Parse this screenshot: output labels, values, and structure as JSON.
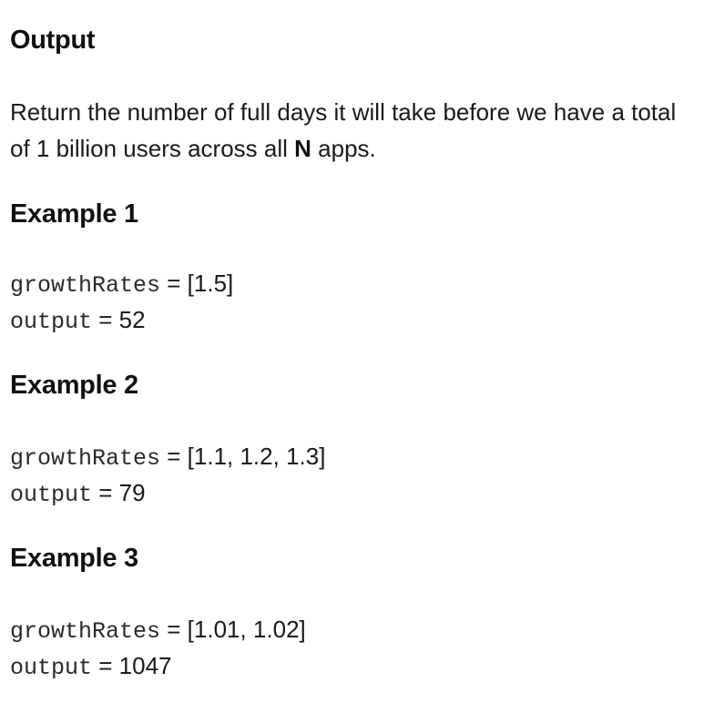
{
  "output_section": {
    "heading": "Output",
    "text_before": "Return the number of full days it will take before we have a total of 1 billion users across all ",
    "emphasis": "N",
    "text_after": " apps."
  },
  "examples": [
    {
      "heading": "Example 1",
      "input_name": "growthRates",
      "input_value": " = [1.5]",
      "output_name": "output",
      "output_value": " = 52"
    },
    {
      "heading": "Example 2",
      "input_name": "growthRates",
      "input_value": " = [1.1, 1.2, 1.3]",
      "output_name": "output",
      "output_value": " = 79"
    },
    {
      "heading": "Example 3",
      "input_name": "growthRates",
      "input_value": " = [1.01, 1.02]",
      "output_name": "output",
      "output_value": " = 1047"
    }
  ]
}
